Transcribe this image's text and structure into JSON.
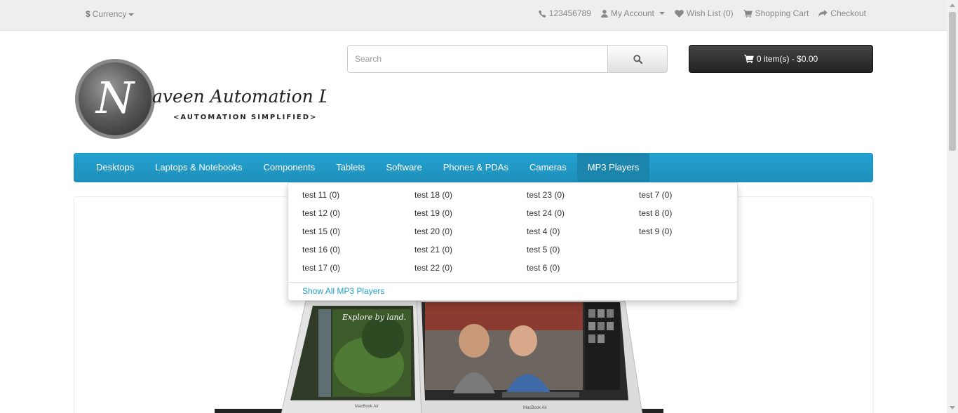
{
  "topbar": {
    "currency_label": "Currency",
    "currency_symbol": "$",
    "phone": "123456789",
    "my_account": "My Account",
    "wish_list": "Wish List (0)",
    "shopping_cart": "Shopping Cart",
    "checkout": "Checkout"
  },
  "logo": {
    "initial": "N",
    "name": "aveen Automation Labs",
    "tagline": "<AUTOMATION SIMPLIFIED>"
  },
  "search": {
    "placeholder": "Search"
  },
  "cart": {
    "label": "0 item(s) - $0.00"
  },
  "menu": {
    "items": [
      "Desktops",
      "Laptops & Notebooks",
      "Components",
      "Tablets",
      "Software",
      "Phones & PDAs",
      "Cameras",
      "MP3 Players"
    ],
    "active": "MP3 Players"
  },
  "dropdown": {
    "columns": [
      [
        "test 11 (0)",
        "test 12 (0)",
        "test 15 (0)",
        "test 16 (0)",
        "test 17 (0)"
      ],
      [
        "test 18 (0)",
        "test 19 (0)",
        "test 20 (0)",
        "test 21 (0)",
        "test 22 (0)"
      ],
      [
        "test 23 (0)",
        "test 24 (0)",
        "test 4 (0)",
        "test 5 (0)",
        "test 6 (0)"
      ],
      [
        "test 7 (0)",
        "test 8 (0)",
        "test 9 (0)"
      ]
    ],
    "show_all": "Show All MP3 Players"
  },
  "slide": {
    "screen_text": "Explore by land.",
    "brand_left": "MacBook Air",
    "brand_right": "MacBook Air"
  },
  "colors": {
    "menu_blue": "#23a1d1",
    "cart_dark": "#2f2f2f",
    "link_blue": "#23a1d1"
  }
}
